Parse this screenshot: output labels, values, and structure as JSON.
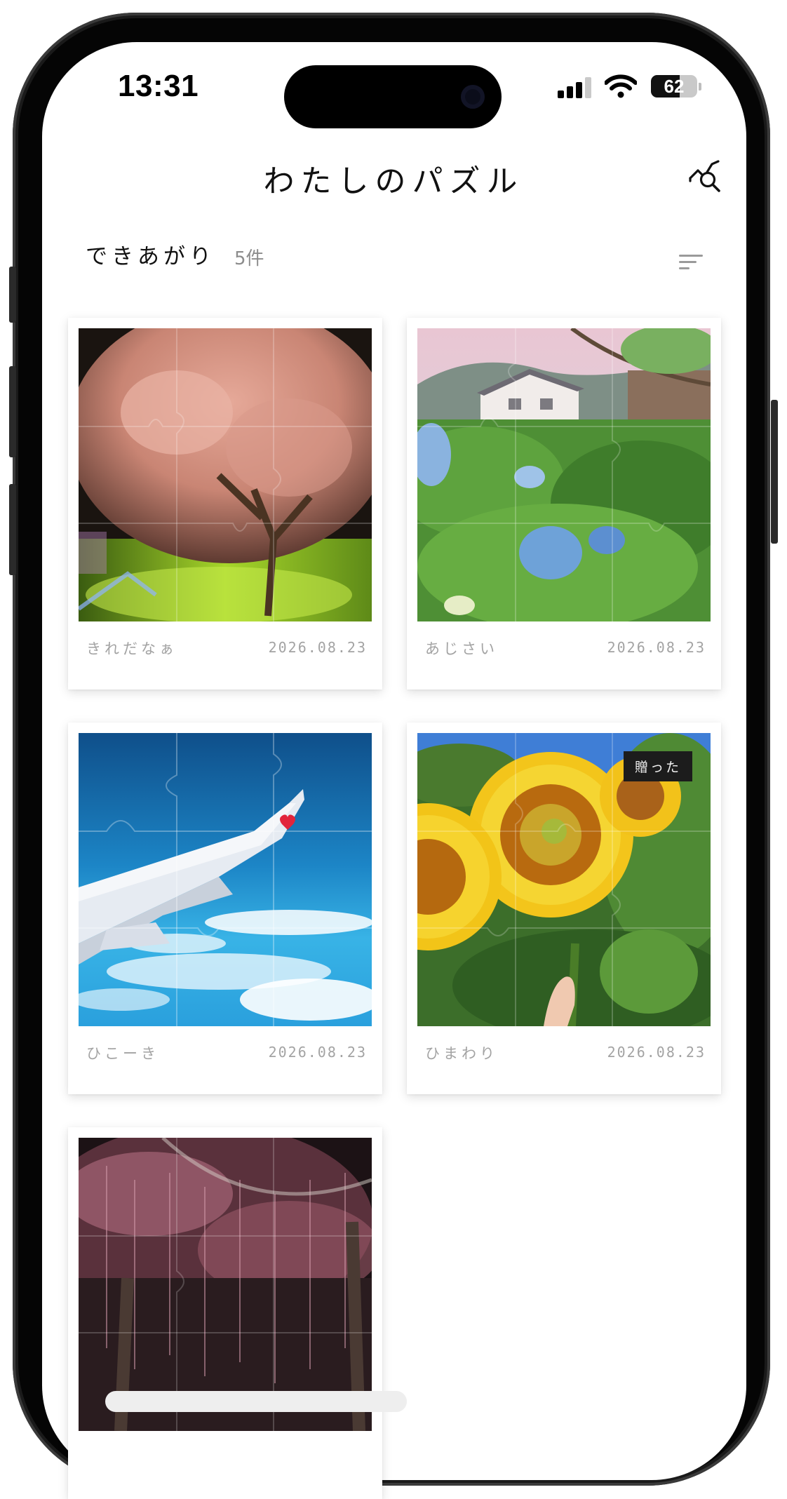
{
  "status_bar": {
    "time": "13:31",
    "battery_level": "62",
    "battery_fraction": 0.62,
    "signal_bars_filled": 3,
    "signal_bars_total": 4,
    "icons": [
      "cellular-signal-icon",
      "wifi-icon",
      "battery-icon"
    ]
  },
  "header": {
    "title": "わたしのパズル",
    "action_icon": "stats-search-icon"
  },
  "section": {
    "title": "できあがり",
    "count": "5件",
    "sort_icon": "sort-icon"
  },
  "puzzles": [
    {
      "caption": "きれだなぁ",
      "date": "2026.08.23",
      "badge": "",
      "photo": "cherry-blossom-tree-at-night"
    },
    {
      "caption": "あじさい",
      "date": "2026.08.23",
      "badge": "",
      "photo": "hydrangea-garden"
    },
    {
      "caption": "ひこーき",
      "date": "2026.08.23",
      "badge": "",
      "photo": "airplane-wing-over-clouds"
    },
    {
      "caption": "ひまわり",
      "date": "2026.08.23",
      "badge": "贈った",
      "photo": "sunflowers"
    },
    {
      "caption": "",
      "date": "",
      "badge": "",
      "photo": "plum-blossom-tree-at-night"
    }
  ],
  "colors": {
    "text_primary": "#111111",
    "text_muted": "#a3a3a3",
    "badge_bg": "#1c1c1c"
  }
}
